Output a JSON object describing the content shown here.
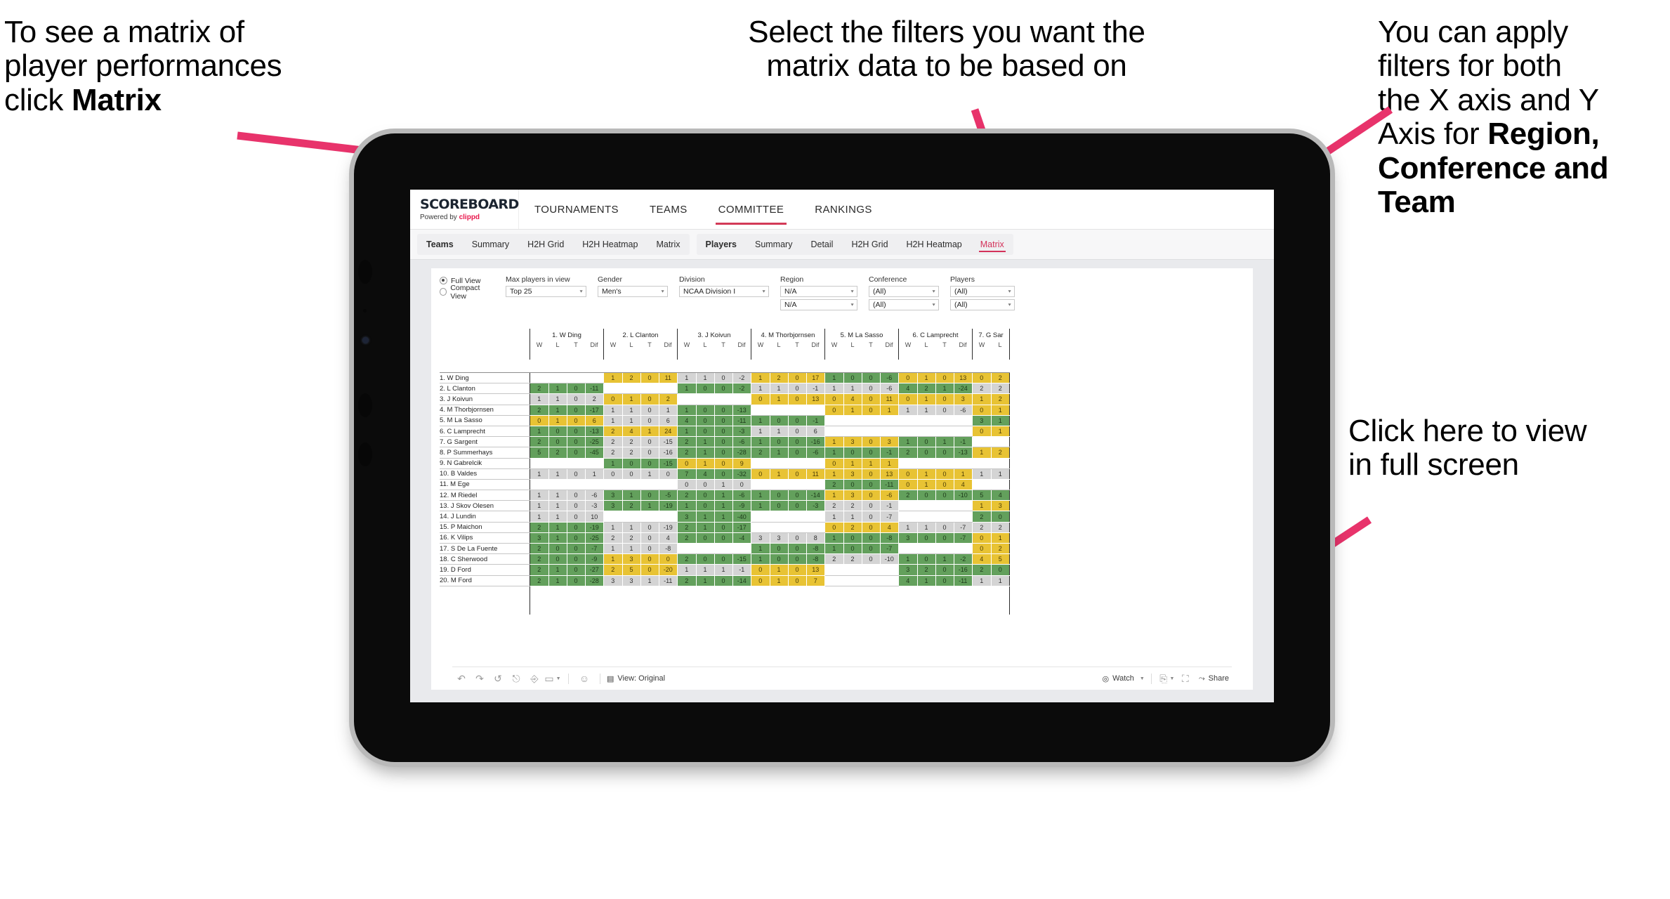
{
  "annotations": {
    "left": {
      "l1": "To see a matrix of",
      "l2": "player performances",
      "l3": "click ",
      "l3b": "Matrix"
    },
    "middle": {
      "l1": "Select the filters you want the",
      "l2": "matrix data to be based on"
    },
    "right": {
      "l1": "You  can apply",
      "l2": "filters for both",
      "l3": "the X axis and Y",
      "l4a": "Axis for ",
      "l4b": "Region,",
      "l5": "Conference and",
      "l6": "Team"
    },
    "fullscreen": {
      "l1": "Click here to view",
      "l2": "in full screen"
    }
  },
  "app": {
    "logo": {
      "main": "SCOREBOARD",
      "powered": "Powered by ",
      "brand": "clippd"
    },
    "mainnav": [
      "TOURNAMENTS",
      "TEAMS",
      "COMMITTEE",
      "RANKINGS"
    ],
    "mainnav_active": "COMMITTEE",
    "subnav_teams": {
      "head": "Teams",
      "items": [
        "Summary",
        "H2H Grid",
        "H2H Heatmap",
        "Matrix"
      ]
    },
    "subnav_players": {
      "head": "Players",
      "items": [
        "Summary",
        "Detail",
        "H2H Grid",
        "H2H Heatmap",
        "Matrix"
      ],
      "active": "Matrix"
    }
  },
  "filters": {
    "view_modes": [
      {
        "label": "Full View",
        "selected": true
      },
      {
        "label": "Compact View",
        "selected": false
      }
    ],
    "max_players": {
      "label": "Max players in view",
      "value": "Top 25"
    },
    "gender": {
      "label": "Gender",
      "value": "Men's"
    },
    "division": {
      "label": "Division",
      "value": "NCAA Division I"
    },
    "region": {
      "label": "Region",
      "value_x": "N/A",
      "value_y": "N/A"
    },
    "conference": {
      "label": "Conference",
      "value_x": "(All)",
      "value_y": "(All)"
    },
    "players": {
      "label": "Players",
      "value_x": "(All)",
      "value_y": "(All)"
    }
  },
  "matrix": {
    "sub_headers": [
      "W",
      "L",
      "T",
      "Dif"
    ],
    "columns": [
      "1. W Ding",
      "2. L Clanton",
      "3. J Koivun",
      "4. M Thorbjornsen",
      "5. M La Sasso",
      "6. C Lamprecht",
      "7. G Sar"
    ],
    "rows": [
      "1. W Ding",
      "2. L Clanton",
      "3. J Koivun",
      "4. M Thorbjornsen",
      "5. M La Sasso",
      "6. C Lamprecht",
      "7. G Sargent",
      "8. P Summerhays",
      "9. N Gabrelcik",
      "10. B Valdes",
      "11. M Ege",
      "12. M Riedel",
      "13. J Skov Olesen",
      "14. J Lundin",
      "15. P Maichon",
      "16. K Vilips",
      "17. S De La Fuente",
      "18. C Sherwood",
      "19. D Ford",
      "20. M Ford"
    ],
    "legend_colors": {
      "win": "#63a05c",
      "loss": "#e8c334",
      "neutral": "#d4d4d4",
      "empty": "#ffffff"
    },
    "cells": [
      [
        null,
        [
          "y",
          1,
          2,
          0,
          11
        ],
        [
          "n",
          1,
          1,
          0,
          -2
        ],
        [
          "y",
          1,
          2,
          0,
          17
        ],
        [
          "g",
          1,
          0,
          0,
          -6
        ],
        [
          "y",
          0,
          1,
          0,
          13
        ],
        [
          "y",
          0,
          2
        ]
      ],
      [
        [
          "g",
          2,
          1,
          0,
          -11
        ],
        null,
        [
          "g",
          1,
          0,
          0,
          -2
        ],
        [
          "n",
          1,
          1,
          0,
          -1
        ],
        [
          "n",
          1,
          1,
          0,
          -6
        ],
        [
          "g",
          4,
          2,
          1,
          -24
        ],
        [
          "n",
          2,
          2
        ]
      ],
      [
        [
          "n",
          1,
          1,
          0,
          2
        ],
        [
          "y",
          0,
          1,
          0,
          2
        ],
        null,
        [
          "y",
          0,
          1,
          0,
          13
        ],
        [
          "y",
          0,
          4,
          0,
          11
        ],
        [
          "y",
          0,
          1,
          0,
          3
        ],
        [
          "y",
          1,
          2
        ]
      ],
      [
        [
          "g",
          2,
          1,
          0,
          -17
        ],
        [
          "n",
          1,
          1,
          0,
          1
        ],
        [
          "g",
          1,
          0,
          0,
          -13
        ],
        null,
        [
          "y",
          0,
          1,
          0,
          1
        ],
        [
          "n",
          1,
          1,
          0,
          -6
        ],
        [
          "y",
          0,
          1
        ]
      ],
      [
        [
          "y",
          0,
          1,
          0,
          6
        ],
        [
          "n",
          1,
          1,
          0,
          6
        ],
        [
          "g",
          4,
          0,
          0,
          -11
        ],
        [
          "g",
          1,
          0,
          0,
          -1
        ],
        null,
        null,
        [
          "g",
          3,
          1
        ]
      ],
      [
        [
          "g",
          1,
          0,
          0,
          -13
        ],
        [
          "y",
          2,
          4,
          1,
          24
        ],
        [
          "g",
          1,
          0,
          0,
          -3
        ],
        [
          "n",
          1,
          1,
          0,
          6
        ],
        null,
        null,
        [
          "y",
          0,
          1
        ]
      ],
      [
        [
          "g",
          2,
          0,
          0,
          -25
        ],
        [
          "n",
          2,
          2,
          0,
          -15
        ],
        [
          "g",
          2,
          1,
          0,
          -6
        ],
        [
          "g",
          1,
          0,
          0,
          -16
        ],
        [
          "y",
          1,
          3,
          0,
          3
        ],
        [
          "g",
          1,
          0,
          1,
          -1
        ],
        null
      ],
      [
        [
          "g",
          5,
          2,
          0,
          -45
        ],
        [
          "n",
          2,
          2,
          0,
          -16
        ],
        [
          "g",
          2,
          1,
          0,
          -28
        ],
        [
          "g",
          2,
          1,
          0,
          -6
        ],
        [
          "g",
          1,
          0,
          0,
          -1
        ],
        [
          "g",
          2,
          0,
          0,
          -13
        ],
        [
          "y",
          1,
          2
        ]
      ],
      [
        null,
        [
          "g",
          1,
          0,
          0,
          -15
        ],
        [
          "y",
          0,
          1,
          0,
          9
        ],
        null,
        [
          "y",
          0,
          1,
          1,
          1
        ],
        null,
        null
      ],
      [
        [
          "n",
          1,
          1,
          0,
          1
        ],
        [
          "n",
          0,
          0,
          1,
          0
        ],
        [
          "g",
          7,
          4,
          0,
          -32
        ],
        [
          "y",
          0,
          1,
          0,
          11
        ],
        [
          "y",
          1,
          3,
          0,
          13
        ],
        [
          "y",
          0,
          1,
          0,
          1
        ],
        [
          "n",
          1,
          1
        ]
      ],
      [
        null,
        null,
        [
          "n",
          0,
          0,
          1,
          0
        ],
        null,
        [
          "g",
          2,
          0,
          0,
          -11
        ],
        [
          "y",
          0,
          1,
          0,
          4
        ],
        null
      ],
      [
        [
          "n",
          1,
          1,
          0,
          -6
        ],
        [
          "g",
          3,
          1,
          0,
          -5
        ],
        [
          "g",
          2,
          0,
          1,
          -6
        ],
        [
          "g",
          1,
          0,
          0,
          -14
        ],
        [
          "y",
          1,
          3,
          0,
          -6
        ],
        [
          "g",
          2,
          0,
          0,
          -10
        ],
        [
          "g",
          5,
          4
        ]
      ],
      [
        [
          "n",
          1,
          1,
          0,
          -3
        ],
        [
          "g",
          3,
          2,
          1,
          -19
        ],
        [
          "g",
          1,
          0,
          1,
          -9
        ],
        [
          "g",
          1,
          0,
          0,
          -3
        ],
        [
          "n",
          2,
          2,
          0,
          -1
        ],
        null,
        [
          "y",
          1,
          3
        ]
      ],
      [
        [
          "n",
          1,
          1,
          0,
          10
        ],
        null,
        [
          "g",
          3,
          1,
          1,
          -40
        ],
        null,
        [
          "n",
          1,
          1,
          0,
          -7
        ],
        null,
        [
          "g",
          2,
          0
        ]
      ],
      [
        [
          "g",
          2,
          1,
          0,
          -19
        ],
        [
          "n",
          1,
          1,
          0,
          -19
        ],
        [
          "g",
          2,
          1,
          0,
          -17
        ],
        null,
        [
          "y",
          0,
          2,
          0,
          4
        ],
        [
          "n",
          1,
          1,
          0,
          -7
        ],
        [
          "n",
          2,
          2
        ]
      ],
      [
        [
          "g",
          3,
          1,
          0,
          -25
        ],
        [
          "n",
          2,
          2,
          0,
          4
        ],
        [
          "g",
          2,
          0,
          0,
          -4
        ],
        [
          "n",
          3,
          3,
          0,
          8
        ],
        [
          "g",
          1,
          0,
          0,
          -8
        ],
        [
          "g",
          3,
          0,
          0,
          -7
        ],
        [
          "y",
          0,
          1
        ]
      ],
      [
        [
          "g",
          2,
          0,
          0,
          -7
        ],
        [
          "n",
          1,
          1,
          0,
          -8
        ],
        null,
        [
          "g",
          1,
          0,
          0,
          -8
        ],
        [
          "g",
          1,
          0,
          0,
          -7
        ],
        null,
        [
          "y",
          0,
          2
        ]
      ],
      [
        [
          "g",
          2,
          0,
          0,
          -9
        ],
        [
          "y",
          1,
          3,
          0,
          0
        ],
        [
          "g",
          2,
          0,
          0,
          -15
        ],
        [
          "g",
          1,
          0,
          0,
          -8
        ],
        [
          "n",
          2,
          2,
          0,
          -10
        ],
        [
          "g",
          1,
          0,
          1,
          -2
        ],
        [
          "y",
          4,
          5
        ]
      ],
      [
        [
          "g",
          2,
          1,
          0,
          -27
        ],
        [
          "y",
          2,
          5,
          0,
          -20
        ],
        [
          "n",
          1,
          1,
          1,
          -1
        ],
        [
          "y",
          0,
          1,
          0,
          13
        ],
        null,
        [
          "g",
          3,
          2,
          0,
          -16
        ],
        [
          "g",
          2,
          0
        ]
      ],
      [
        [
          "g",
          2,
          1,
          0,
          -28
        ],
        [
          "n",
          3,
          3,
          1,
          -11
        ],
        [
          "g",
          2,
          1,
          0,
          -14
        ],
        [
          "y",
          0,
          1,
          0,
          7
        ],
        null,
        [
          "g",
          4,
          1,
          0,
          -11
        ],
        [
          "n",
          1,
          1
        ]
      ]
    ]
  },
  "toolbar": {
    "icons": [
      "undo-icon",
      "redo-icon",
      "revert-icon",
      "refresh-icon",
      "pause-icon",
      "device-layout-icon"
    ],
    "view_label": "View: Original",
    "watch_label": "Watch",
    "share_label": "Share"
  }
}
